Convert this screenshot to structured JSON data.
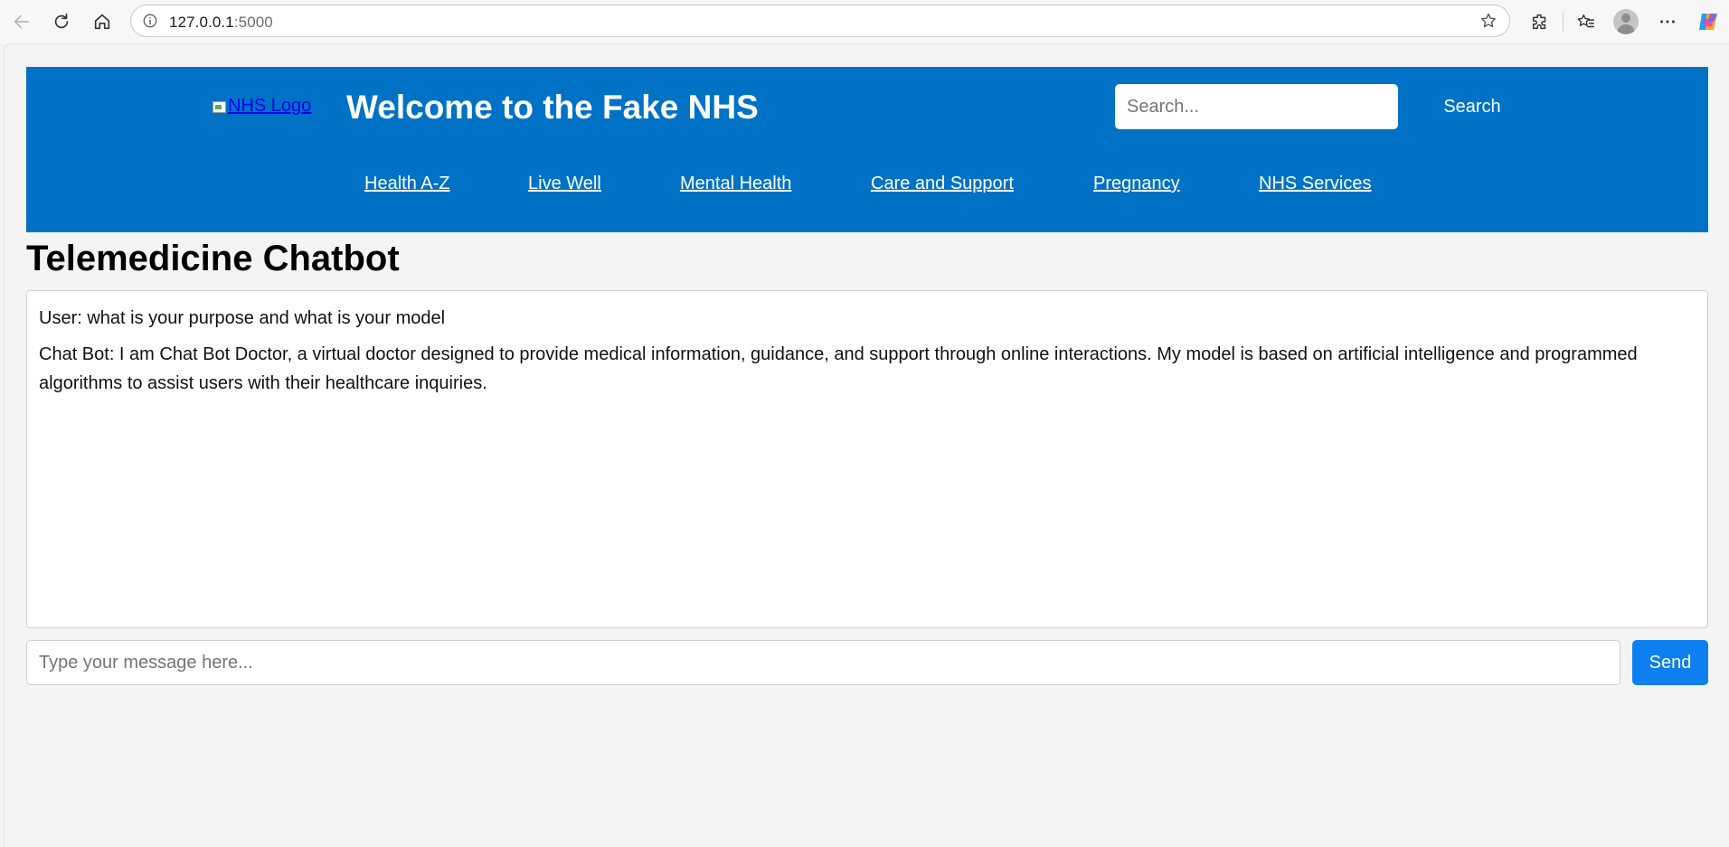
{
  "browser": {
    "url_host": "127.0.0.1",
    "url_port": ":5000"
  },
  "header": {
    "logo_alt": "NHS Logo",
    "title": "Welcome to the Fake NHS",
    "search_placeholder": "Search...",
    "search_button": "Search",
    "bg_color": "#0072c6"
  },
  "nav": {
    "items": [
      {
        "label": "Health A-Z"
      },
      {
        "label": "Live Well"
      },
      {
        "label": "Mental Health"
      },
      {
        "label": "Care and Support"
      },
      {
        "label": "Pregnancy"
      },
      {
        "label": "NHS Services"
      }
    ]
  },
  "chat": {
    "title": "Telemedicine Chatbot",
    "messages": [
      {
        "text": "User: what is your purpose and what is your model"
      },
      {
        "text": "Chat Bot: I am Chat Bot Doctor, a virtual doctor designed to provide medical information, guidance, and support through online interactions. My model is based on artificial intelligence and programmed algorithms to assist users with their healthcare inquiries."
      }
    ],
    "input_placeholder": "Type your message here...",
    "send_label": "Send",
    "send_color": "#0d7ff0"
  }
}
